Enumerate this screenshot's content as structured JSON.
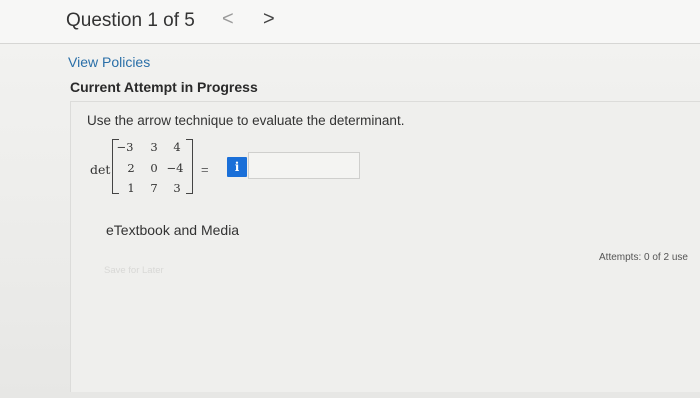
{
  "header": {
    "title": "Question 1 of 5",
    "prev": "<",
    "next": ">"
  },
  "links": {
    "policies": "View Policies"
  },
  "status": {
    "attempt": "Current Attempt in Progress"
  },
  "question": {
    "prompt": "Use the arrow technique to evaluate the determinant.",
    "det_label": "det",
    "matrix": [
      [
        "−3",
        "3",
        "4"
      ],
      [
        "2",
        "0",
        "−4"
      ],
      [
        "1",
        "7",
        "3"
      ]
    ],
    "equals": "=",
    "info_icon": "i",
    "answer_value": ""
  },
  "resources": {
    "etextbook": "eTextbook and Media"
  },
  "actions": {
    "save": "Save for Later"
  },
  "attempts": {
    "text": "Attempts: 0 of 2 use"
  },
  "colors": {
    "link": "#2a6fa8",
    "info_button": "#1a6fd8"
  }
}
